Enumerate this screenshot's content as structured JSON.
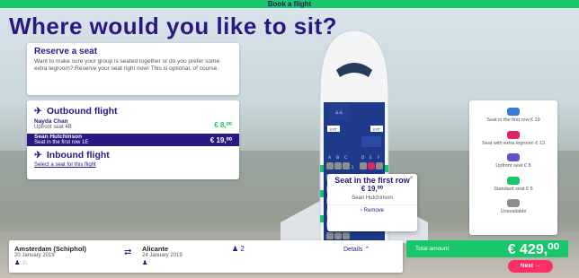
{
  "topbar": {
    "title": "Book a flight"
  },
  "page": {
    "title": "Where would you like to sit?"
  },
  "reserve": {
    "heading": "Reserve a seat",
    "text": "Want to make sure your group is seated together or do you prefer some extra legroom? Reserve your seat right now! This is optional, of course."
  },
  "outbound": {
    "heading": "Outbound flight",
    "passengers": [
      {
        "name": "Nayda Chan",
        "seat": "Upfront seat 4B",
        "price": "€ 8,⁰⁰"
      },
      {
        "name": "Sean Hutchinson",
        "seat": "Seat in the first row 1E",
        "price": "€ 19,⁰⁰"
      }
    ]
  },
  "inbound": {
    "heading": "Inbound flight",
    "link": "Select a seat for this flight"
  },
  "plane": {
    "exit_left": "EXIT",
    "exit_right": "EXIT",
    "cols_left": [
      "A",
      "B",
      "C"
    ],
    "cols_right": [
      "D",
      "E",
      "F"
    ],
    "row_number": "1"
  },
  "popup": {
    "title": "Seat in the first row",
    "price": "€ 19,⁰⁰",
    "name": "Sean Hutchinson",
    "remove": "Remove"
  },
  "legend": {
    "items": [
      {
        "label": "Seat in the first row € 19",
        "color": "#3d7ad6"
      },
      {
        "label": "Seat with extra legroom € 13",
        "color": "#e0245e"
      },
      {
        "label": "Upfront seat € 8",
        "color": "#6a4fc8"
      },
      {
        "label": "Standard seat € 5",
        "color": "#17c76a"
      },
      {
        "label": "Unavailable",
        "color": "#8e8e8e"
      }
    ]
  },
  "footer": {
    "from_city": "Amsterdam (Schiphol)",
    "from_date": "20 January 2019",
    "to_city": "Alicante",
    "to_date": "24 January 2019",
    "pax_count": "2",
    "details": "Details"
  },
  "total": {
    "label": "Total amount",
    "amount": "€ 429,⁰⁰"
  },
  "next": {
    "label": "Next"
  },
  "colors": {
    "brand": "#2a1882",
    "green": "#17c76a",
    "pink": "#ff2e63"
  }
}
